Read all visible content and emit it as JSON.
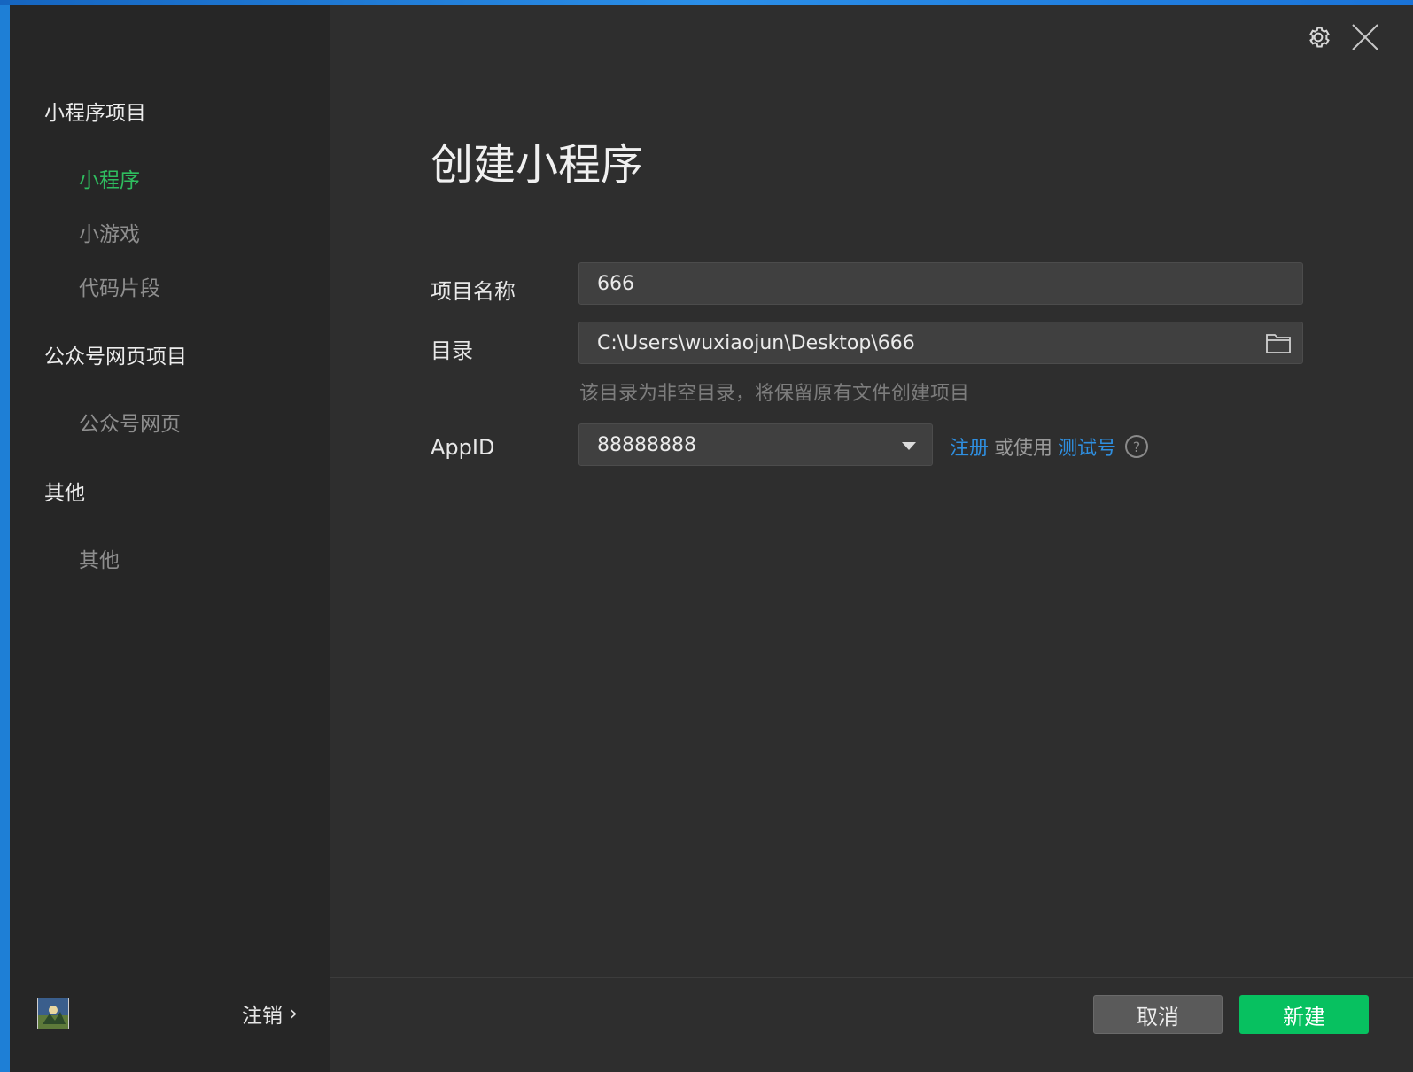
{
  "sidebar": {
    "categories": [
      {
        "label": "小程序项目",
        "items": [
          {
            "label": "小程序",
            "active": true
          },
          {
            "label": "小游戏"
          },
          {
            "label": "代码片段"
          }
        ]
      },
      {
        "label": "公众号网页项目",
        "items": [
          {
            "label": "公众号网页"
          }
        ]
      },
      {
        "label": "其他",
        "items": [
          {
            "label": "其他"
          }
        ]
      }
    ],
    "logout_label": "注销",
    "logout_chevron": "›"
  },
  "header": {
    "settings_icon": "gear-icon",
    "close_icon": "close-icon"
  },
  "main": {
    "title": "创建小程序",
    "form": {
      "name_label": "项目名称",
      "name_value": "666",
      "dir_label": "目录",
      "dir_value": "C:\\Users\\wuxiaojun\\Desktop\\666",
      "dir_hint": "该目录为非空目录，将保留原有文件创建项目",
      "appid_label": "AppID",
      "appid_value": "88888888",
      "register_link": "注册",
      "or_use": "或使用",
      "test_account_link": "测试号",
      "help_glyph": "?"
    }
  },
  "footer": {
    "cancel_label": "取消",
    "create_label": "新建"
  },
  "colors": {
    "accent_green": "#07c160",
    "active_item": "#2fbd5f",
    "link_blue": "#2f8fe0",
    "background": "#2e2e2e",
    "sidebar": "#262626"
  }
}
